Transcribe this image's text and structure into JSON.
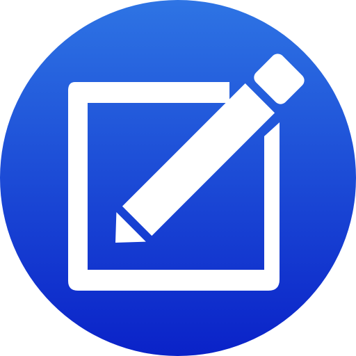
{
  "icon": {
    "name": "edit-compose-icon",
    "depicts": "pencil-over-square",
    "colors": {
      "gradient_top": "#2E74E4",
      "gradient_bottom": "#0A22C8",
      "glyph": "#FFFFFF"
    }
  }
}
